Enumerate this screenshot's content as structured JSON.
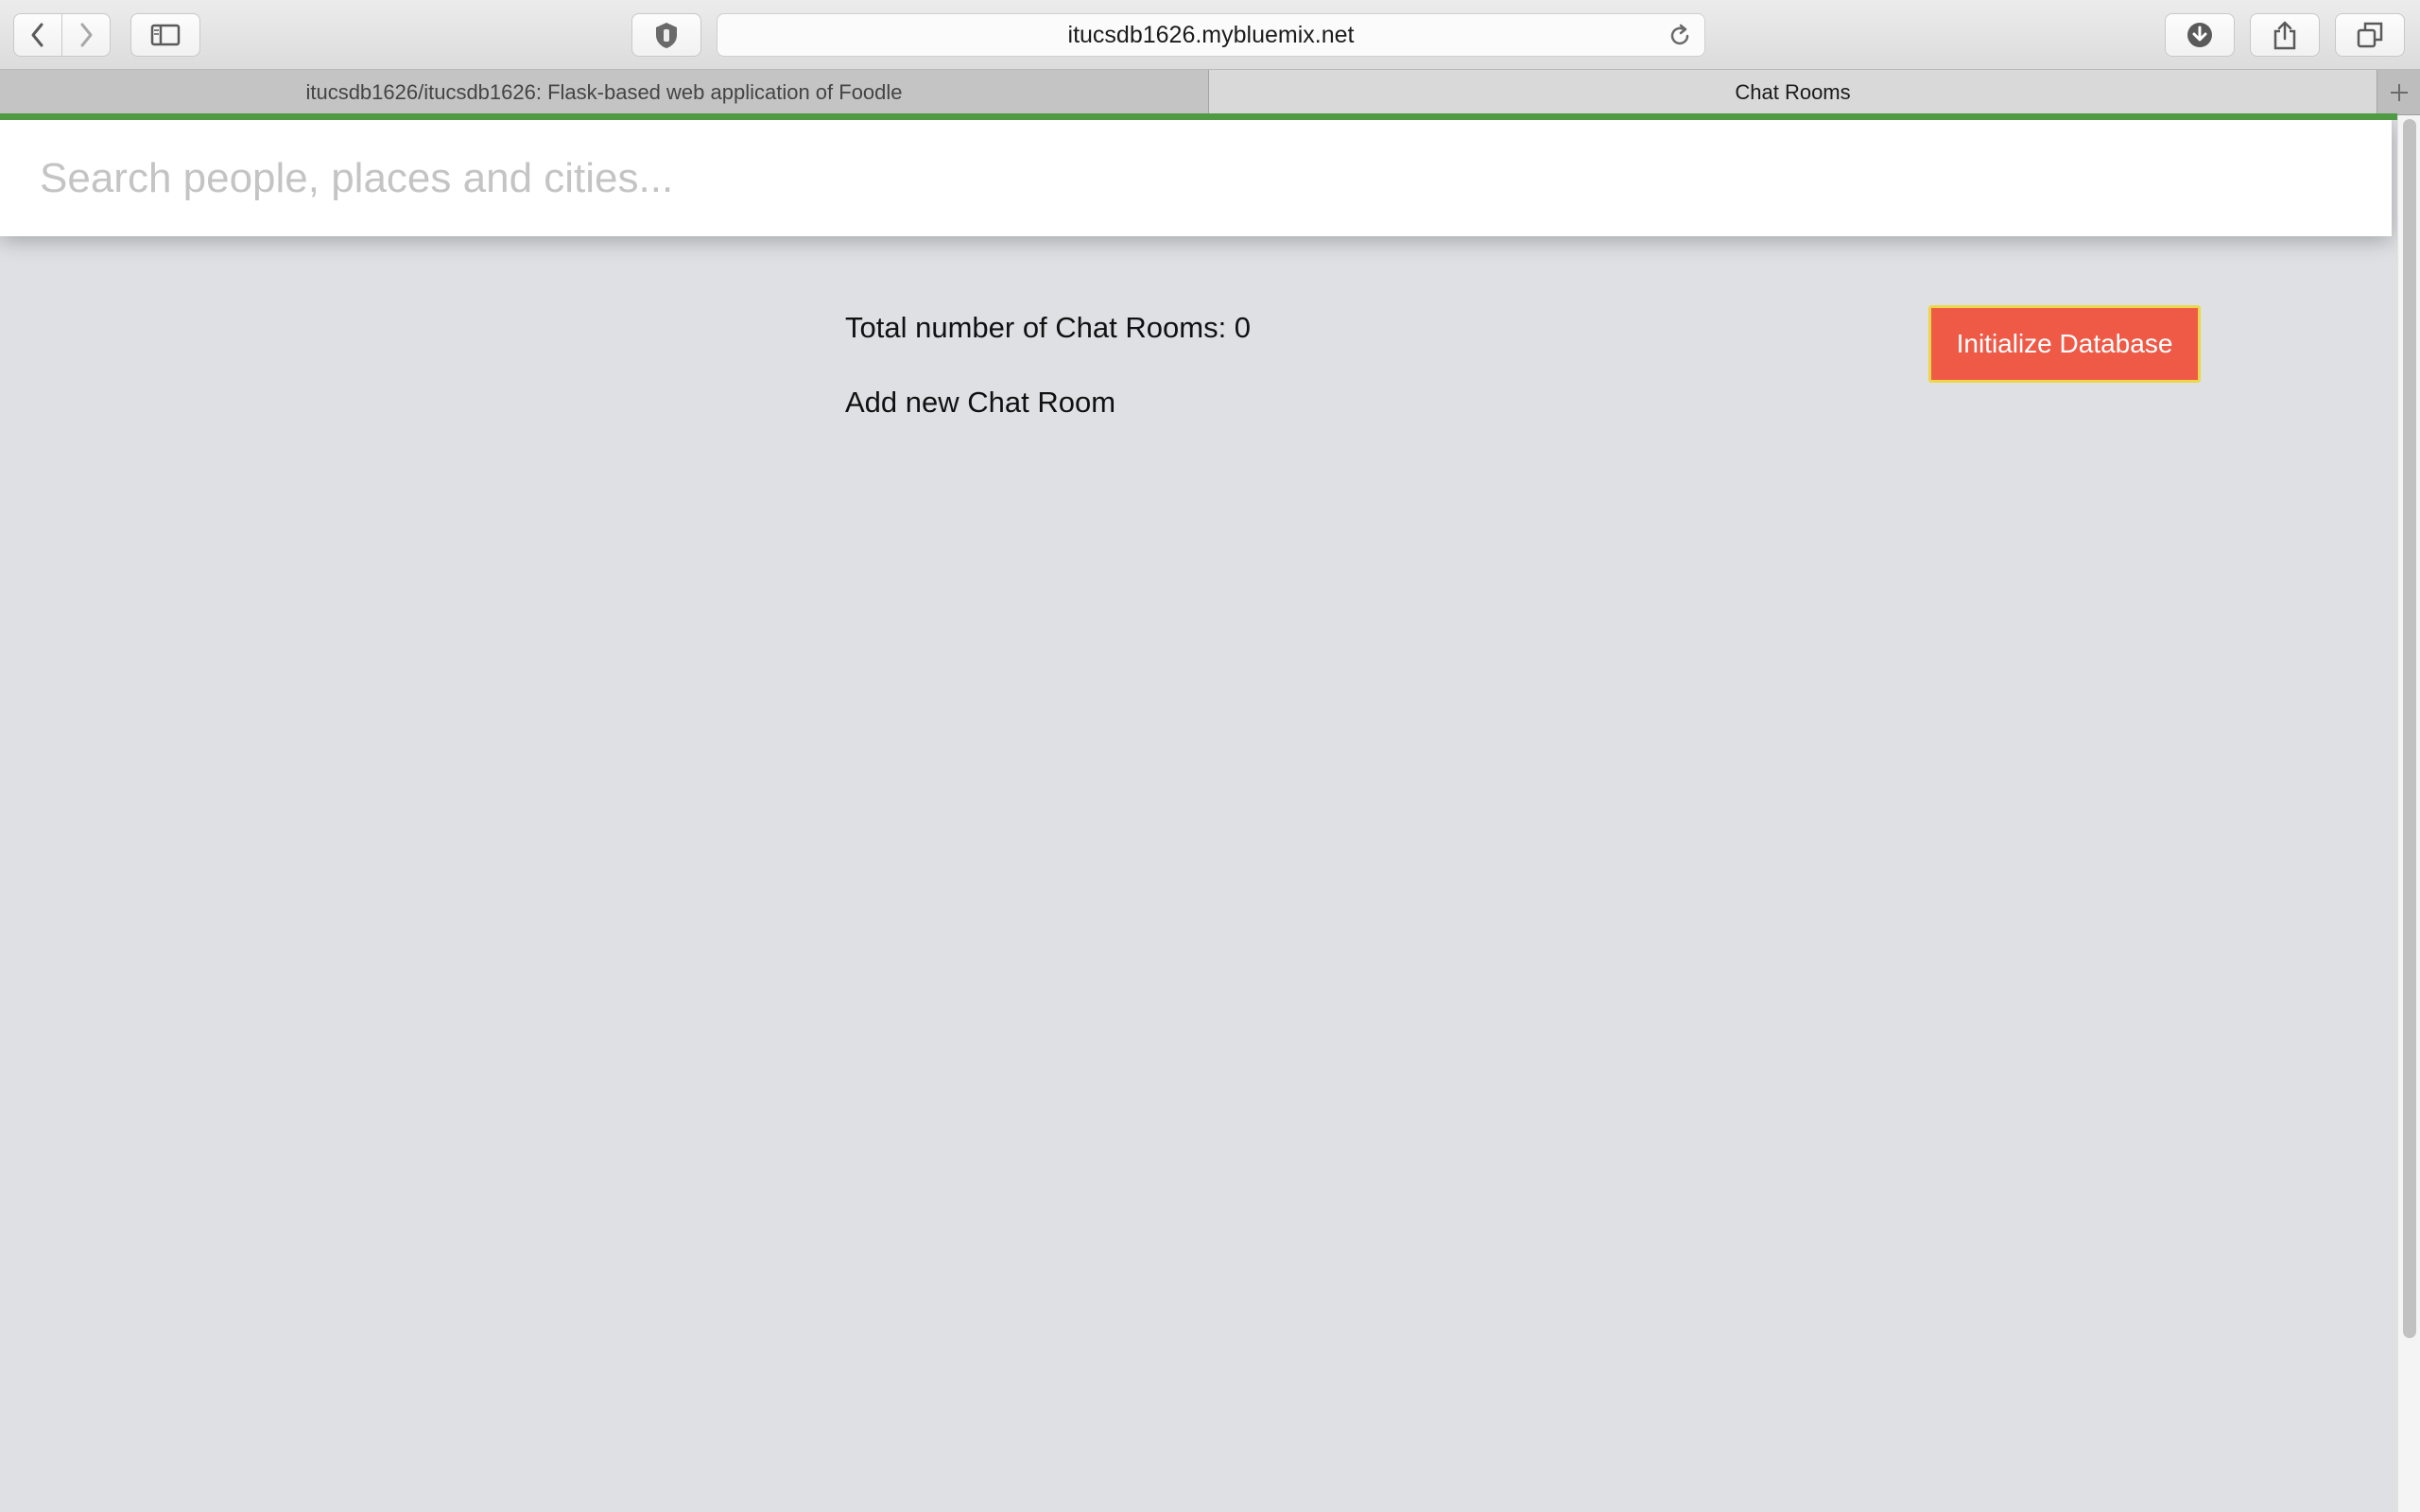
{
  "browser": {
    "url": "itucsdb1626.mybluemix.net",
    "tabs": [
      {
        "label": "itucsdb1626/itucsdb1626: Flask-based web application of Foodle",
        "active": false
      },
      {
        "label": "Chat Rooms",
        "active": true
      }
    ],
    "icons": {
      "back": "chevron-left-icon",
      "forward": "chevron-right-icon",
      "sidebar": "sidebar-icon",
      "extension": "shield-icon",
      "reload": "reload-icon",
      "download": "download-icon",
      "share": "share-icon",
      "tabs": "tabs-overview-icon",
      "new_tab": "plus-icon"
    },
    "loading_bar_color": "#4f9a43"
  },
  "page": {
    "search": {
      "placeholder": "Search people, places and cities..."
    },
    "total_label": "Total number of Chat Rooms: 0",
    "add_label": "Add new Chat Room",
    "init_button_label": "Initialize Database",
    "init_button_color": "#ef5a47",
    "background_color": "#dfe0e4"
  }
}
